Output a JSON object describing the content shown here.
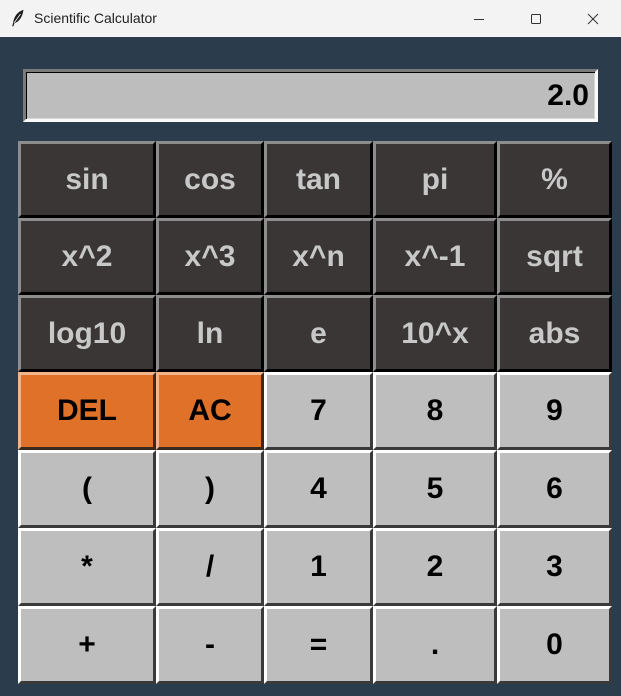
{
  "window": {
    "title": "Scientific Calculator",
    "controls": {
      "minimize": "minimize-icon",
      "maximize": "maximize-icon",
      "close": "close-icon"
    }
  },
  "display": {
    "value": "2.0"
  },
  "keypad": {
    "rows": [
      [
        {
          "label": "sin",
          "style": "dark"
        },
        {
          "label": "cos",
          "style": "dark"
        },
        {
          "label": "tan",
          "style": "dark"
        },
        {
          "label": "pi",
          "style": "dark"
        },
        {
          "label": "%",
          "style": "dark"
        }
      ],
      [
        {
          "label": "x^2",
          "style": "dark"
        },
        {
          "label": "x^3",
          "style": "dark"
        },
        {
          "label": "x^n",
          "style": "dark"
        },
        {
          "label": "x^-1",
          "style": "dark"
        },
        {
          "label": "sqrt",
          "style": "dark"
        }
      ],
      [
        {
          "label": "log10",
          "style": "dark"
        },
        {
          "label": "ln",
          "style": "dark"
        },
        {
          "label": "e",
          "style": "dark"
        },
        {
          "label": "10^x",
          "style": "dark"
        },
        {
          "label": "abs",
          "style": "dark"
        }
      ],
      [
        {
          "label": "DEL",
          "style": "orange"
        },
        {
          "label": "AC",
          "style": "orange"
        },
        {
          "label": "7",
          "style": "light"
        },
        {
          "label": "8",
          "style": "light"
        },
        {
          "label": "9",
          "style": "light"
        }
      ],
      [
        {
          "label": "(",
          "style": "light"
        },
        {
          "label": ")",
          "style": "light"
        },
        {
          "label": "4",
          "style": "light"
        },
        {
          "label": "5",
          "style": "light"
        },
        {
          "label": "6",
          "style": "light"
        }
      ],
      [
        {
          "label": "*",
          "style": "light"
        },
        {
          "label": "/",
          "style": "light"
        },
        {
          "label": "1",
          "style": "light"
        },
        {
          "label": "2",
          "style": "light"
        },
        {
          "label": "3",
          "style": "light"
        }
      ],
      [
        {
          "label": "+",
          "style": "light"
        },
        {
          "label": "-",
          "style": "light"
        },
        {
          "label": "=",
          "style": "light"
        },
        {
          "label": ".",
          "style": "light"
        },
        {
          "label": "0",
          "style": "light"
        }
      ]
    ]
  },
  "colors": {
    "background": "#2b3d4d",
    "function_key": "#3a3636",
    "digit_key": "#bebebe",
    "accent_key": "#df7128",
    "display": "#bdbdbd"
  }
}
